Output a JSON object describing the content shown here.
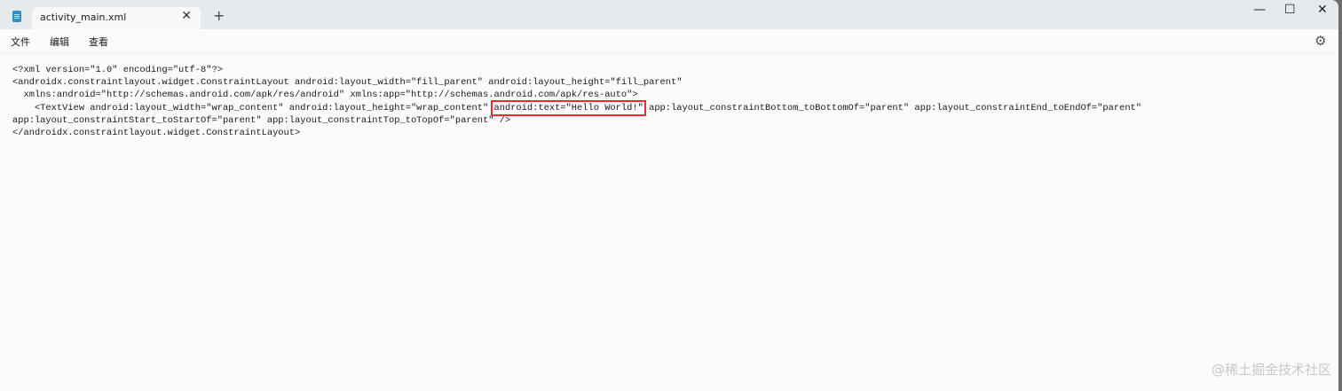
{
  "tab": {
    "title": "activity_main.xml",
    "close": "✕",
    "new_tab": "+"
  },
  "window": {
    "minimize": "—",
    "maximize": "☐",
    "close": "✕"
  },
  "menu": {
    "file": "文件",
    "edit": "编辑",
    "view": "查看",
    "settings": "⚙"
  },
  "editor": {
    "line1": "<?xml version=\"1.0\" encoding=\"utf-8\"?>",
    "line2": "<androidx.constraintlayout.widget.ConstraintLayout android:layout_width=\"fill_parent\" android:layout_height=\"fill_parent\"",
    "line3": "  xmlns:android=\"http://schemas.android.com/apk/res/android\" xmlns:app=\"http://schemas.android.com/apk/res-auto\">",
    "line4a": "    <TextView android:layout_width=\"wrap_content\" android:layout_height=\"wrap_content\" ",
    "line4b": "android:text=\"Hello World!\"",
    "line4c": " app:layout_constraintBottom_toBottomOf=\"parent\" app:layout_constraintEnd_toEndOf=\"parent\"",
    "line5": "app:layout_constraintStart_toStartOf=\"parent\" app:layout_constraintTop_toTopOf=\"parent\" />",
    "line6": "</androidx.constraintlayout.widget.ConstraintLayout>"
  },
  "watermark": "@稀土掘金技术社区"
}
